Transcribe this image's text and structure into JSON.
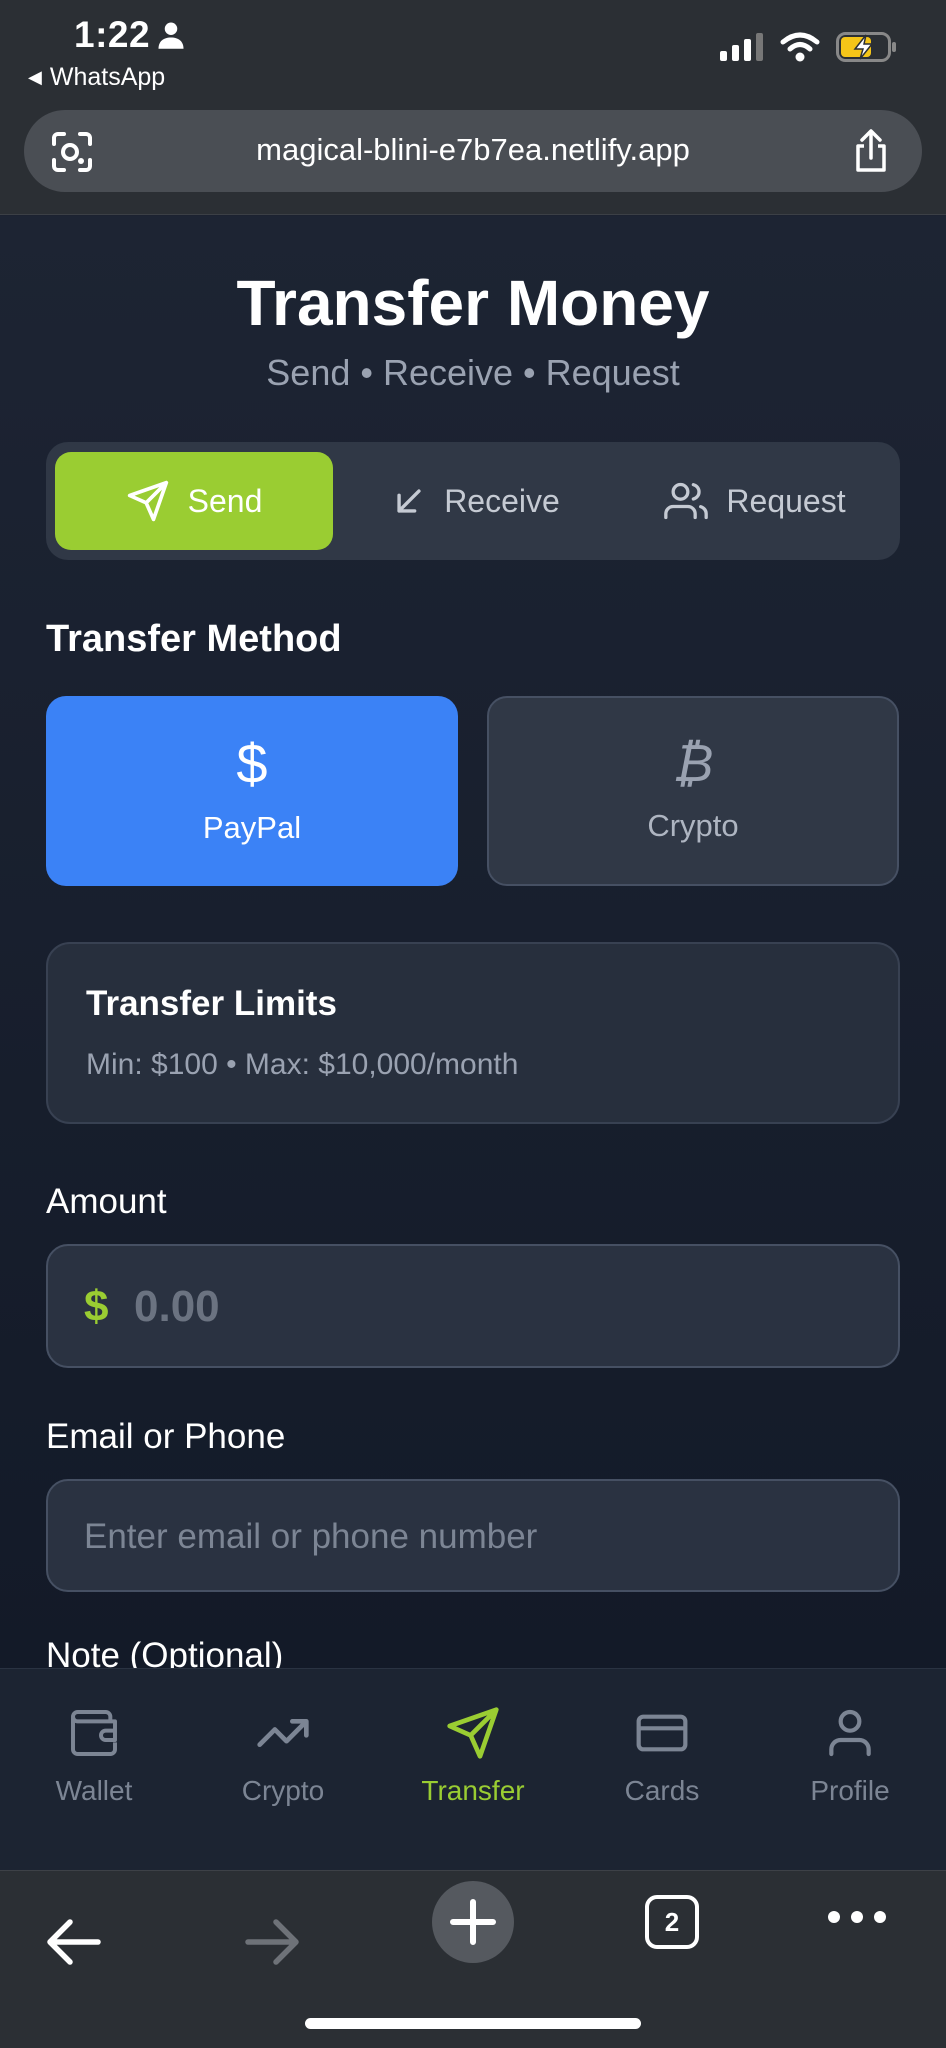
{
  "status_bar": {
    "time": "1:22",
    "back_app": "WhatsApp"
  },
  "browser": {
    "url": "magical-blini-e7b7ea.netlify.app",
    "tab_count": "2"
  },
  "header": {
    "title": "Transfer Money",
    "subtitle": "Send • Receive • Request"
  },
  "mode_tabs": [
    {
      "label": "Send",
      "icon": "send-icon",
      "active": true
    },
    {
      "label": "Receive",
      "icon": "arrow-down-left-icon",
      "active": false
    },
    {
      "label": "Request",
      "icon": "users-icon",
      "active": false
    }
  ],
  "transfer_method": {
    "heading": "Transfer Method",
    "options": [
      {
        "label": "PayPal",
        "icon": "dollar-icon",
        "active": true
      },
      {
        "label": "Crypto",
        "icon": "bitcoin-icon",
        "active": false
      }
    ]
  },
  "limits": {
    "title": "Transfer Limits",
    "text": "Min: $100 • Max: $10,000/month"
  },
  "amount": {
    "label": "Amount",
    "currency_symbol": "$",
    "placeholder": "0.00"
  },
  "contact": {
    "label": "Email or Phone",
    "placeholder": "Enter email or phone number"
  },
  "note": {
    "label": "Note (Optional)"
  },
  "bottom_nav": [
    {
      "label": "Wallet",
      "icon": "wallet-icon",
      "active": false
    },
    {
      "label": "Crypto",
      "icon": "trending-up-icon",
      "active": false
    },
    {
      "label": "Transfer",
      "icon": "send-icon",
      "active": true
    },
    {
      "label": "Cards",
      "icon": "credit-card-icon",
      "active": false
    },
    {
      "label": "Profile",
      "icon": "user-icon",
      "active": false
    }
  ],
  "colors": {
    "accent_green": "#9acd32",
    "paypal_blue": "#3b82f6",
    "background": "#1c2230"
  }
}
